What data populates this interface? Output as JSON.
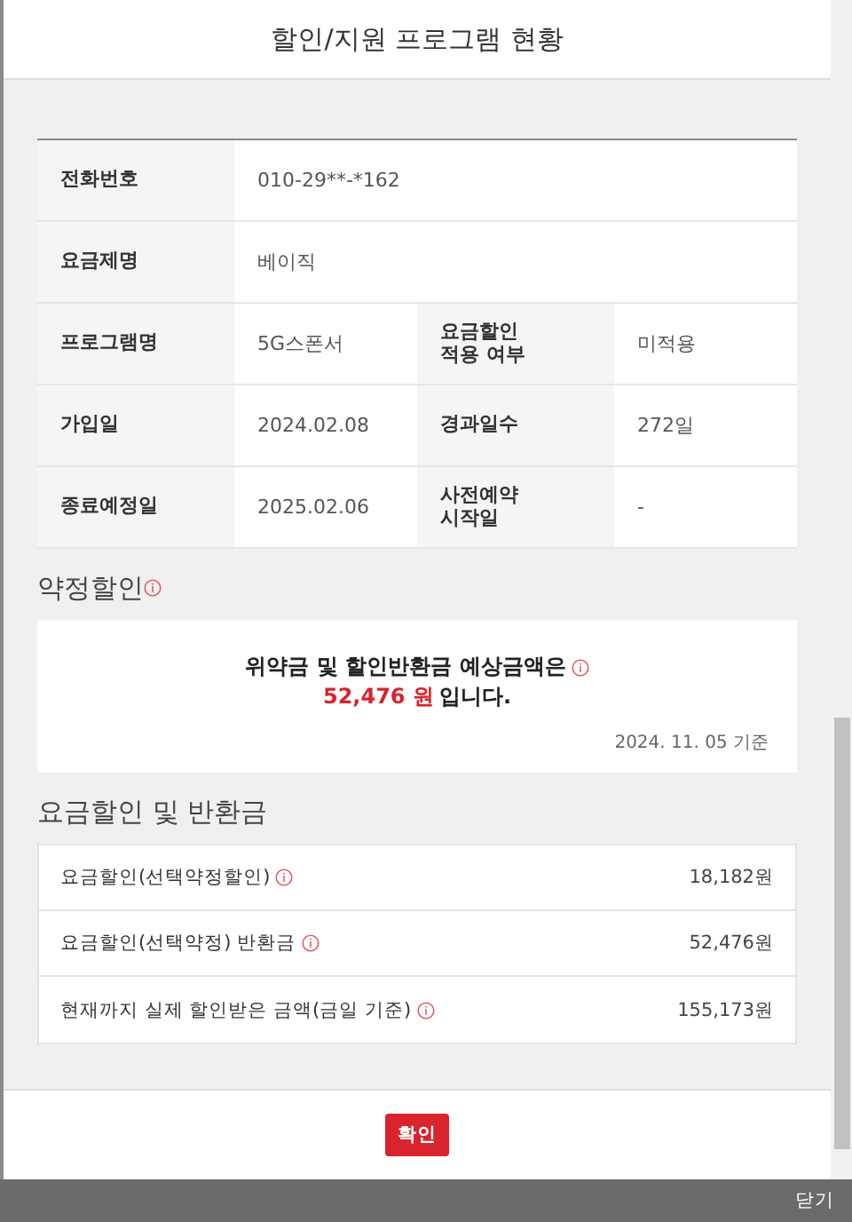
{
  "dialog": {
    "title": "할인/지원 프로그램 현황"
  },
  "info_table": [
    {
      "cells": [
        {
          "label": "전화번호",
          "value": "010-29**-*162"
        }
      ]
    },
    {
      "cells": [
        {
          "label": "요금제명",
          "value": "베이직"
        }
      ]
    },
    {
      "cells": [
        {
          "label": "프로그램명",
          "value": "5G스폰서"
        },
        {
          "label": "요금할인\n적용 여부",
          "value": "미적용"
        }
      ]
    },
    {
      "cells": [
        {
          "label": "가입일",
          "value": "2024.02.08"
        },
        {
          "label": "경과일수",
          "value": "272일"
        }
      ]
    },
    {
      "cells": [
        {
          "label": "종료예정일",
          "value": "2025.02.06"
        },
        {
          "label": "사전예약\n시작일",
          "value": "-"
        }
      ]
    }
  ],
  "contract_section": {
    "title": "약정할인",
    "notice": "위약금 및 할인반환금 예상금액은",
    "amount": "52,476 원",
    "amount_suffix": "입니다.",
    "as_of": "2024. 11. 05 기준"
  },
  "refund_section": {
    "title": "요금할인 및 반환금",
    "rows": [
      {
        "label": "요금할인(선택약정할인)",
        "value": "18,182원"
      },
      {
        "label": "요금할인(선택약정) 반환금",
        "value": "52,476원"
      },
      {
        "label": "현재까지 실제 할인받은 금액(금일 기준)",
        "value": "155,173원"
      }
    ]
  },
  "confirm_button": "확인",
  "close_bar": "닫기"
}
